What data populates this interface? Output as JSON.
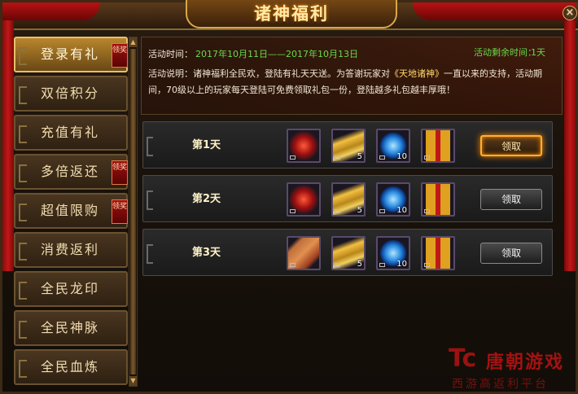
{
  "window": {
    "title": "诸神福利",
    "close_label": "×"
  },
  "sidebar": {
    "items": [
      {
        "label": "登录有礼",
        "badge": "领奖",
        "active": true
      },
      {
        "label": "双倍积分",
        "badge": "",
        "active": false
      },
      {
        "label": "充值有礼",
        "badge": "",
        "active": false
      },
      {
        "label": "多倍返还",
        "badge": "领奖",
        "active": false
      },
      {
        "label": "超值限购",
        "badge": "领奖",
        "active": false
      },
      {
        "label": "消费返利",
        "badge": "",
        "active": false
      },
      {
        "label": "全民龙印",
        "badge": "",
        "active": false
      },
      {
        "label": "全民神脉",
        "badge": "",
        "active": false
      },
      {
        "label": "全民血炼",
        "badge": "",
        "active": false
      }
    ]
  },
  "info": {
    "time_label": "活动时间：",
    "time_value": "2017年10月11日——2017年10月13日",
    "remain_label": "活动剩余时间：",
    "remain_value": "1天",
    "desc_prefix": "活动说明：诸神福利全民欢，登陆有礼天天送。为答谢玩家对",
    "desc_highlight": "《天地诸神》",
    "desc_suffix": "一直以来的支持，活动期间，70级以上的玩家每天登陆可免费领取礼包一份，登陆越多礼包越丰厚哦！"
  },
  "rows": [
    {
      "label": "第1天",
      "button": "领取",
      "glow": true,
      "items": [
        {
          "icon": "red-gem-icon",
          "qty": ""
        },
        {
          "icon": "gold-bars-icon",
          "qty": "5"
        },
        {
          "icon": "blue-orb-icon",
          "qty": "10"
        },
        {
          "icon": "gift-box-icon",
          "qty": ""
        }
      ]
    },
    {
      "label": "第2天",
      "button": "领取",
      "glow": false,
      "items": [
        {
          "icon": "red-gem-icon",
          "qty": ""
        },
        {
          "icon": "gold-bars-icon",
          "qty": "5"
        },
        {
          "icon": "blue-orb-icon",
          "qty": "10"
        },
        {
          "icon": "gift-box-icon",
          "qty": ""
        }
      ]
    },
    {
      "label": "第3天",
      "button": "领取",
      "glow": false,
      "items": [
        {
          "icon": "scroll-book-icon",
          "qty": ""
        },
        {
          "icon": "gold-bars-icon",
          "qty": "5"
        },
        {
          "icon": "blue-orb-icon",
          "qty": "10"
        },
        {
          "icon": "gift-box-icon",
          "qty": ""
        }
      ]
    }
  ],
  "watermark": {
    "logo": "Tc",
    "name": "唐朝游戏",
    "sub": "西游高返利平台"
  },
  "colors": {
    "accent_gold": "#e7c06a",
    "timer_green": "#6ad84a",
    "ribbon_red": "#c01818"
  }
}
